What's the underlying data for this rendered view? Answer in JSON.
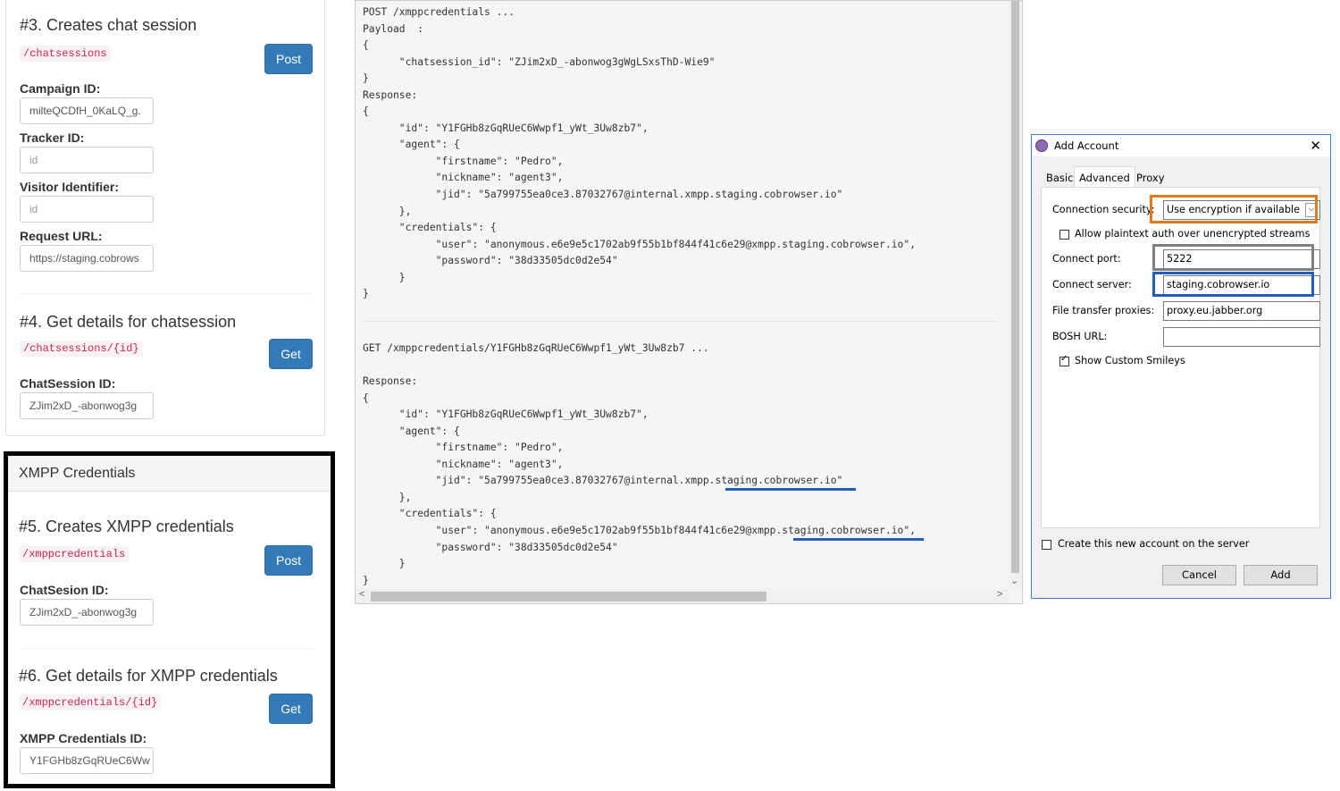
{
  "left": {
    "s3": {
      "title": "#3. Creates chat session",
      "endpoint": "/chatsessions",
      "button": "Post",
      "fields": [
        {
          "label": "Campaign ID:",
          "value": "milteQCDfH_0KaLQ_g.",
          "placeholder": ""
        },
        {
          "label": "Tracker ID:",
          "value": "",
          "placeholder": "id"
        },
        {
          "label": "Visitor Identifier:",
          "value": "",
          "placeholder": "id"
        },
        {
          "label": "Request URL:",
          "value": "https://staging.cobrows",
          "placeholder": ""
        }
      ]
    },
    "s4": {
      "title": "#4. Get details for chatsession",
      "endpoint": "/chatsessions/{id}",
      "button": "Get",
      "field": {
        "label": "ChatSession ID:",
        "value": "ZJim2xD_-abonwog3g"
      }
    },
    "xmpp": {
      "header": "XMPP Credentials",
      "s5": {
        "title": "#5. Creates XMPP credentials",
        "endpoint": "/xmppcredentials",
        "button": "Post",
        "field": {
          "label": "ChatSesion ID:",
          "value": "ZJim2xD_-abonwog3g"
        }
      },
      "s6": {
        "title": "#6. Get details for XMPP credentials",
        "endpoint": "/xmppcredentials/{id}",
        "button": "Get",
        "field": {
          "label": "XMPP Credentials ID:",
          "value": "Y1FGHb8zGqRUeC6Ww"
        }
      }
    }
  },
  "log": {
    "block1": "POST /xmppcredentials ...\nPayload  :\n{\n      \"chatsession_id\": \"ZJim2xD_-abonwog3gWgLSxsThD-Wie9\"\n}\nResponse:\n{\n      \"id\": \"Y1FGHb8zGqRUeC6Wwpf1_yWt_3Uw8zb7\",\n      \"agent\": {\n            \"firstname\": \"Pedro\",\n            \"nickname\": \"agent3\",\n            \"jid\": \"5a799755ea0ce3.87032767@internal.xmpp.staging.cobrowser.io\"\n      },\n      \"credentials\": {\n            \"user\": \"anonymous.e6e9e5c1702ab9f55b1bf844f41c6e29@xmpp.staging.cobrowser.io\",\n            \"password\": \"38d33505dc0d2e54\"\n      }\n}",
    "block2": "GET /xmppcredentials/Y1FGHb8zGqRUeC6Wwpf1_yWt_3Uw8zb7 ...\n\nResponse:\n{\n      \"id\": \"Y1FGHb8zGqRUeC6Wwpf1_yWt_3Uw8zb7\",\n      \"agent\": {\n            \"firstname\": \"Pedro\",\n            \"nickname\": \"agent3\",\n            \"jid\": \"5a799755ea0ce3.87032767@internal.xmpp.staging.cobrowser.io\"\n      },\n      \"credentials\": {\n            \"user\": \"anonymous.e6e9e5c1702ab9f55b1bf844f41c6e29@xmpp.staging.cobrowser.io\",\n            \"password\": \"38d33505dc0d2e54\"\n      }\n}"
  },
  "dialog": {
    "title": "Add Account",
    "tabs": [
      "Basic",
      "Advanced",
      "Proxy"
    ],
    "connection_security_label": "Connection security:",
    "connection_security_value": "Use encryption if available",
    "allow_plaintext_label": "Allow plaintext auth over unencrypted streams",
    "connect_port_label": "Connect port:",
    "connect_port_value": "5222",
    "connect_server_label": "Connect server:",
    "connect_server_value": "staging.cobrowser.io",
    "file_transfer_label": "File transfer proxies:",
    "file_transfer_value": "proxy.eu.jabber.org",
    "bosh_label": "BOSH URL:",
    "bosh_value": "",
    "show_smileys_label": "Show Custom Smileys",
    "create_account_label": "Create this new account on the server",
    "cancel": "Cancel",
    "add": "Add"
  },
  "colors": {
    "primary": "#337ab7",
    "code": "#c7254e",
    "highlight_orange": "#e37b1b",
    "highlight_blue": "#1f5fb7",
    "highlight_gray": "#7f7f7f"
  }
}
